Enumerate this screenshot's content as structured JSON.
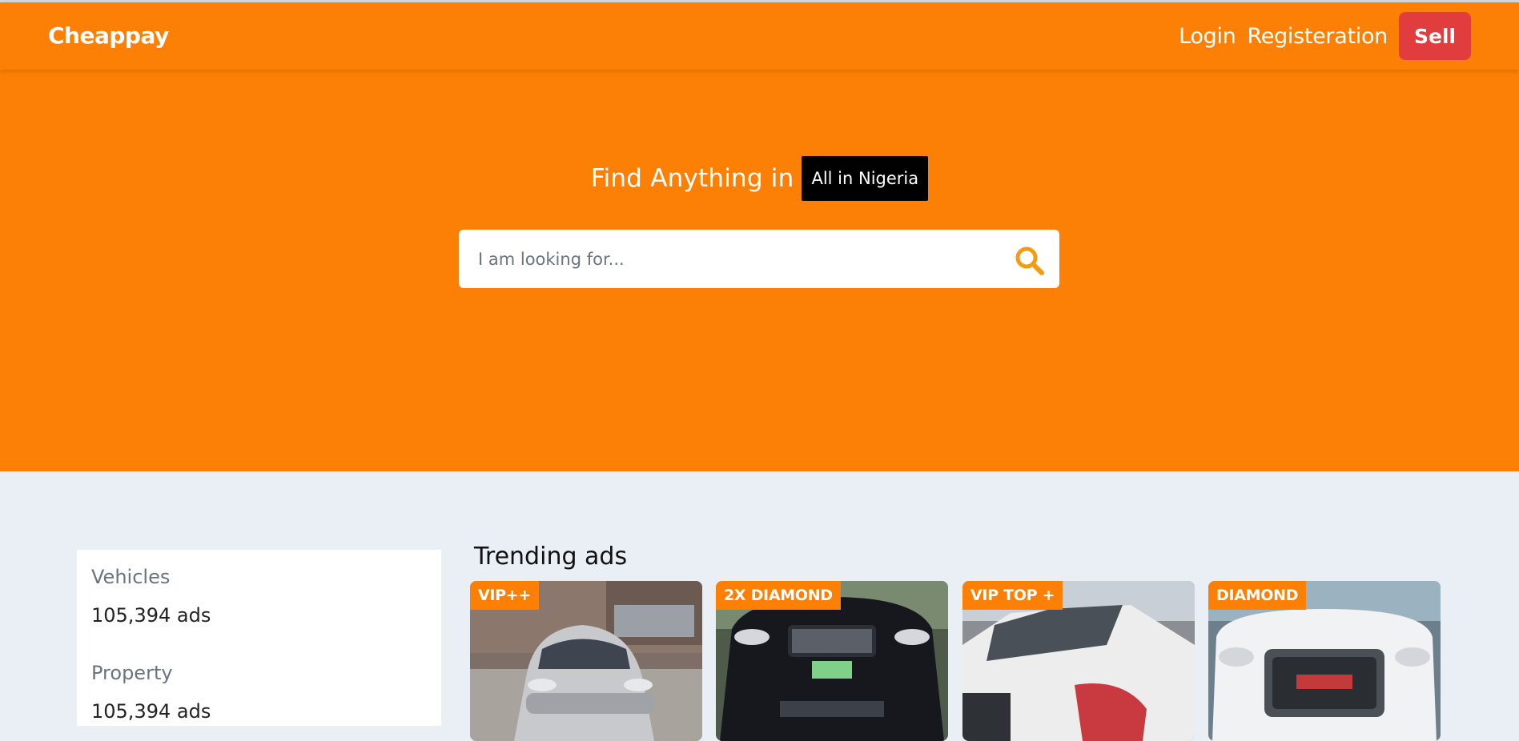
{
  "navbar": {
    "brand": "Cheappay",
    "login": "Login",
    "register": "Registeration",
    "sell": "Sell"
  },
  "hero": {
    "title": "Find Anything in",
    "location": "All in Nigeria",
    "search_placeholder": "I am looking for..."
  },
  "sidebar": {
    "categories": [
      {
        "name": "Vehicles",
        "count": "105,394 ads"
      },
      {
        "name": "Property",
        "count": "105,394 ads"
      }
    ]
  },
  "trending": {
    "title": "Trending ads",
    "cards": [
      {
        "tag": "VIP++"
      },
      {
        "tag": "2X DIAMOND"
      },
      {
        "tag": "VIP TOP +"
      },
      {
        "tag": "DIAMOND"
      }
    ]
  },
  "colors": {
    "primary": "#fc8005",
    "sell": "#e13c3e",
    "location_badge": "#000000",
    "background": "#e9eff5",
    "search_icon": "#f39c12"
  }
}
